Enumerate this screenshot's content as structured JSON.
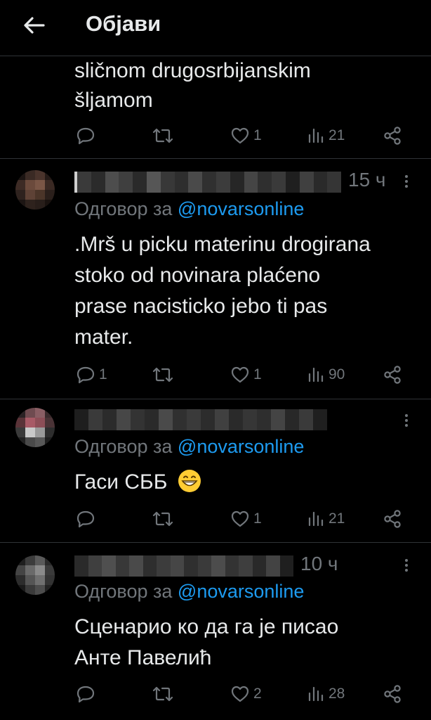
{
  "header": {
    "title": "Објави",
    "back_icon": "arrow-left-icon"
  },
  "top_tweet": {
    "text_line1": "sličnom drugosrbijanskim",
    "text_line2": "šljamom",
    "counts": {
      "replies": "",
      "reposts": "",
      "likes": "1",
      "views": "21"
    }
  },
  "replies": [
    {
      "time": "15 ч",
      "reply_prefix": "Одговор за",
      "reply_handle": "@novarsonline",
      "text_lines": [
        ".Mrš u picku materinu drogirana",
        "stoko od novinara plaćeno",
        "prase nacisticko jebo ti pas",
        "mater."
      ],
      "counts": {
        "replies": "1",
        "reposts": "",
        "likes": "1",
        "views": "90"
      }
    },
    {
      "time": "",
      "reply_prefix": "Одговор за",
      "reply_handle": "@novarsonline",
      "text_lines": [
        "Гаси СББ"
      ],
      "emoji": "grinning-face-icon",
      "counts": {
        "replies": "",
        "reposts": "",
        "likes": "1",
        "views": "21"
      }
    },
    {
      "time": "10 ч",
      "reply_prefix": "Одговор за",
      "reply_handle": "@novarsonline",
      "text_lines": [
        "Сценарио ко да га је писао",
        "Анте Павелић"
      ],
      "counts": {
        "replies": "",
        "reposts": "",
        "likes": "2",
        "views": "28"
      }
    }
  ],
  "colors": {
    "background": "#000000",
    "text": "#e7e9ea",
    "muted": "#71767b",
    "accent": "#1d9bf0",
    "divider": "#2f3336"
  }
}
